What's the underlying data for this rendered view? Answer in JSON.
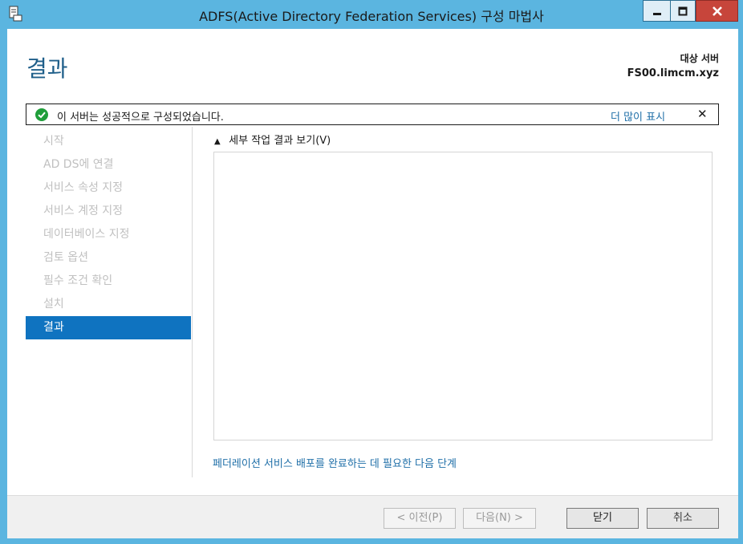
{
  "window": {
    "title": "ADFS(Active Directory Federation Services) 구성 마법사",
    "icons": {
      "app": "server-wizard-icon",
      "minimize": "minimize-icon",
      "maximize": "maximize-icon",
      "close": "close-icon"
    },
    "colors": {
      "title_bar": "#5bb5e0",
      "close_button": "#c7453b"
    }
  },
  "header": {
    "page_title": "결과",
    "target_server_label": "대상 서버",
    "target_server_value": "FS00.limcm.xyz"
  },
  "notification": {
    "icon": "success-check-icon",
    "message": "이 서버는 성공적으로 구성되었습니다.",
    "more_link": "더 많이 표시",
    "close_glyph": "✕"
  },
  "nav": {
    "items": [
      {
        "label": "시작",
        "active": false
      },
      {
        "label": "AD DS에 연결",
        "active": false
      },
      {
        "label": "서비스 속성 지정",
        "active": false
      },
      {
        "label": "서비스 계정 지정",
        "active": false
      },
      {
        "label": "데이터베이스 지정",
        "active": false
      },
      {
        "label": "검토 옵션",
        "active": false
      },
      {
        "label": "필수 조건 확인",
        "active": false
      },
      {
        "label": "설치",
        "active": false
      },
      {
        "label": "결과",
        "active": true
      }
    ],
    "active_color": "#0f73c0"
  },
  "main": {
    "details_toggle": "세부 작업 결과 보기(V)",
    "details_toggle_glyph": "▲",
    "next_steps_link": "페더레이션 서비스 배포를 완료하는 데 필요한 다음 단계"
  },
  "footer": {
    "prev_label": "< 이전(P)",
    "next_label": "다음(N) >",
    "close_label": "닫기",
    "cancel_label": "취소"
  }
}
